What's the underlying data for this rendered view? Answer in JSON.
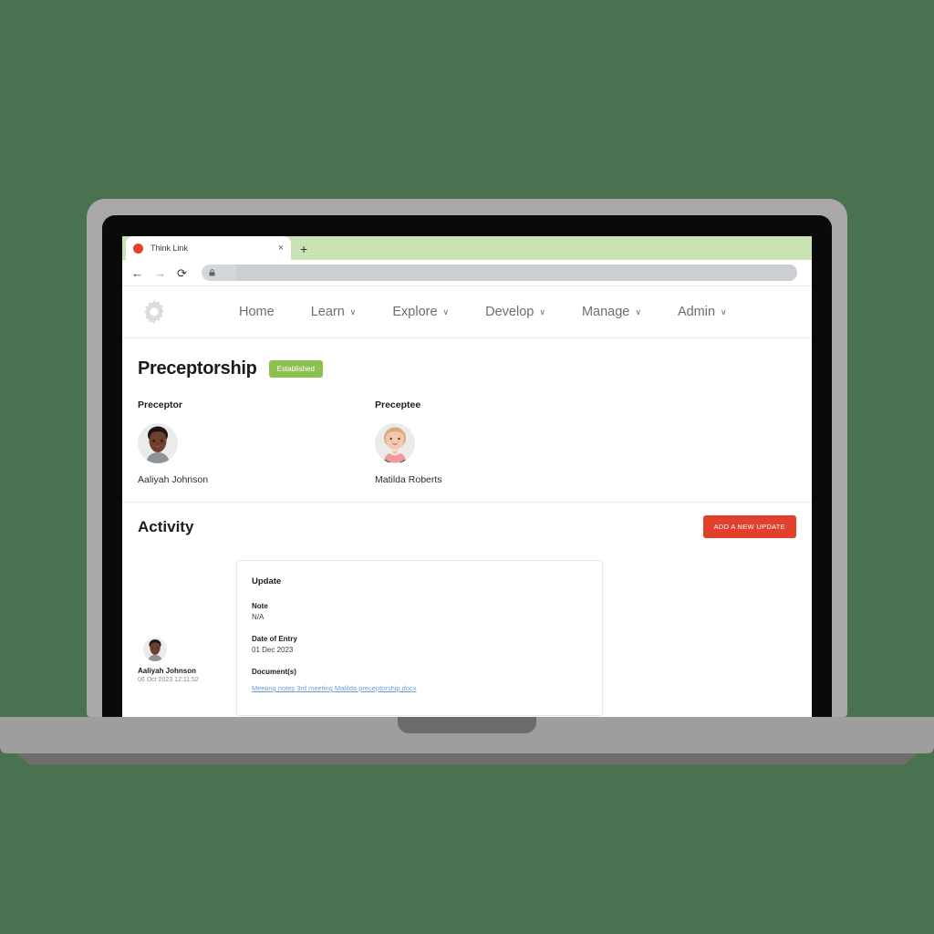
{
  "browser": {
    "tab_title": "Think Link",
    "tab_close_label": "×",
    "new_tab_label": "+",
    "back_label": "←",
    "forward_label": "→",
    "reload_label": "⟳",
    "url_value": "",
    "url_placeholder": ""
  },
  "app": {
    "logo_icon": "gear-icon",
    "nav": [
      {
        "label": "Home",
        "has_caret": false
      },
      {
        "label": "Learn",
        "has_caret": true
      },
      {
        "label": "Explore",
        "has_caret": true
      },
      {
        "label": "Develop",
        "has_caret": true
      },
      {
        "label": "Manage",
        "has_caret": true
      },
      {
        "label": "Admin",
        "has_caret": true
      }
    ],
    "caret_glyph": "∨"
  },
  "page": {
    "title": "Preceptorship",
    "status_badge": "Established",
    "status_badge_color": "#8cc152"
  },
  "people": {
    "preceptor": {
      "role_label": "Preceptor",
      "name": "Aaliyah Johnson"
    },
    "preceptee": {
      "role_label": "Preceptee",
      "name": "Matilda Roberts"
    }
  },
  "activity": {
    "heading": "Activity",
    "add_button_label": "ADD A NEW UPDATE",
    "add_button_color": "#e0402c",
    "entries": [
      {
        "author_name": "Aaliyah Johnson",
        "timestamp": "06 Oct 2023 12:11:52",
        "card_title": "Update",
        "note_label": "Note",
        "note_value": "N/A",
        "date_label": "Date of Entry",
        "date_value": "01 Dec 2023",
        "documents_label": "Document(s)",
        "document_name": "Meeting notes 3rd meeting Matilda preceptorship.docx"
      }
    ]
  }
}
